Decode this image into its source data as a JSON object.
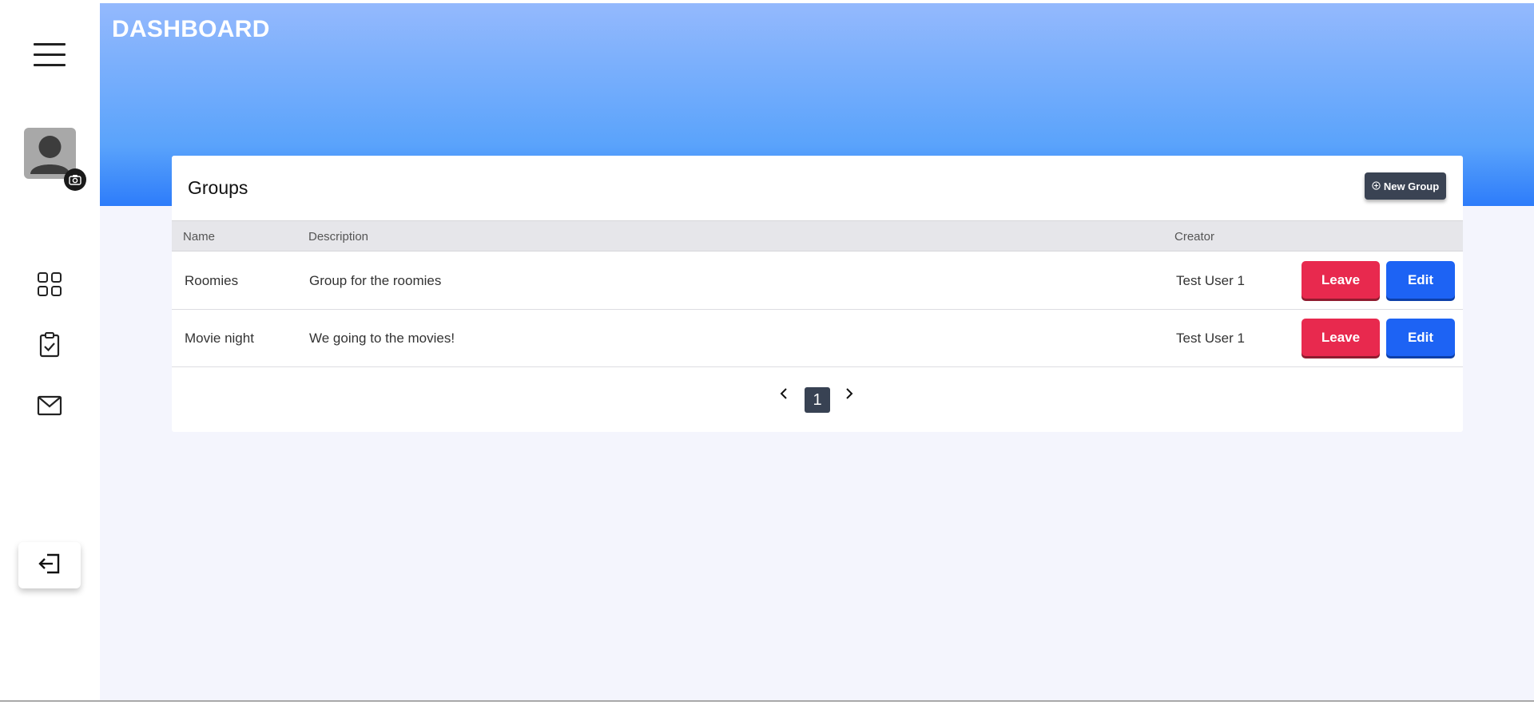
{
  "header": {
    "title": "DASHBOARD"
  },
  "sidebar": {
    "menu_icon": "hamburger-menu-icon",
    "avatar_icon": "user-avatar-icon",
    "camera_icon": "camera-icon",
    "nav": [
      {
        "icon": "grid-dashboard-icon"
      },
      {
        "icon": "clipboard-check-icon"
      },
      {
        "icon": "mail-icon"
      }
    ],
    "logout_icon": "logout-icon"
  },
  "groups_card": {
    "title": "Groups",
    "new_group_label": "New Group",
    "new_group_icon": "plus-circle-icon",
    "columns": {
      "name": "Name",
      "description": "Description",
      "creator": "Creator"
    },
    "rows": [
      {
        "name": "Roomies",
        "description": "Group for the roomies",
        "creator": "Test User 1",
        "leave_label": "Leave",
        "edit_label": "Edit"
      },
      {
        "name": "Movie night",
        "description": "We going to the movies!",
        "creator": "Test User 1",
        "leave_label": "Leave",
        "edit_label": "Edit"
      }
    ],
    "pagination": {
      "current_page": "1",
      "prev_icon": "chevron-left-icon",
      "next_icon": "chevron-right-icon"
    }
  },
  "colors": {
    "leave": "#e8294e",
    "edit": "#1d63f4",
    "header_gradient_top": "#94b9fd",
    "header_gradient_bottom": "#2d7cfa",
    "dark_button": "#3a4353"
  }
}
